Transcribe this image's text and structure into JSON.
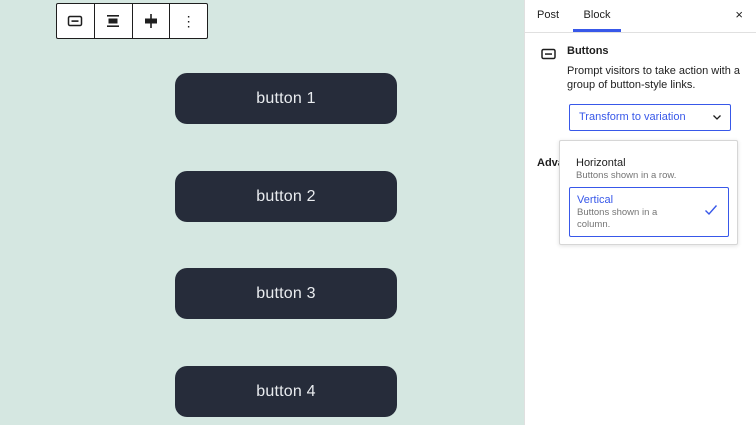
{
  "canvas": {
    "background": "#d5e7e1",
    "toolbar": {
      "items": [
        {
          "icon": "buttons-block-icon"
        },
        {
          "icon": "justify-icon"
        },
        {
          "icon": "vertical-align-icon"
        },
        {
          "icon": "more-options-icon",
          "glyph": "⋮"
        }
      ]
    },
    "buttons": [
      "button 1",
      "button 2",
      "button 3",
      "button 4"
    ],
    "button_color": "#262c3a"
  },
  "sidebar": {
    "tabs": {
      "post": "Post",
      "block": "Block"
    },
    "close_glyph": "×",
    "block": {
      "title": "Buttons",
      "description": "Prompt visitors to take action with a group of button-style links."
    },
    "transform_label": "Transform to variation",
    "advanced_label": "Advanced",
    "accent": "#3858e9"
  },
  "dropdown": {
    "options": [
      {
        "title": "Horizontal",
        "description": "Buttons shown in a row.",
        "selected": false
      },
      {
        "title": "Vertical",
        "description": "Buttons shown in a column.",
        "selected": true
      }
    ]
  }
}
